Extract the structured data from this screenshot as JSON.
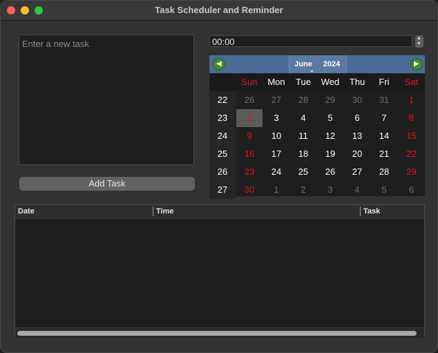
{
  "window": {
    "title": "Task Scheduler and Reminder"
  },
  "task_input": {
    "placeholder": "Enter a new task",
    "value": ""
  },
  "add_button": {
    "label": "Add Task"
  },
  "time_edit": {
    "value": "00:00"
  },
  "calendar": {
    "month": "June",
    "year": "2024",
    "day_headers": [
      "Sun",
      "Mon",
      "Tue",
      "Wed",
      "Thu",
      "Fri",
      "Sat"
    ],
    "selected_day": 2,
    "weeks": [
      {
        "week": "22",
        "days": [
          {
            "d": "26",
            "o": true
          },
          {
            "d": "27",
            "o": true
          },
          {
            "d": "28",
            "o": true
          },
          {
            "d": "29",
            "o": true
          },
          {
            "d": "30",
            "o": true
          },
          {
            "d": "31",
            "o": true
          },
          {
            "d": "1",
            "o": false
          }
        ]
      },
      {
        "week": "23",
        "days": [
          {
            "d": "2",
            "o": false
          },
          {
            "d": "3",
            "o": false
          },
          {
            "d": "4",
            "o": false
          },
          {
            "d": "5",
            "o": false
          },
          {
            "d": "6",
            "o": false
          },
          {
            "d": "7",
            "o": false
          },
          {
            "d": "8",
            "o": false
          }
        ]
      },
      {
        "week": "24",
        "days": [
          {
            "d": "9",
            "o": false
          },
          {
            "d": "10",
            "o": false
          },
          {
            "d": "11",
            "o": false
          },
          {
            "d": "12",
            "o": false
          },
          {
            "d": "13",
            "o": false
          },
          {
            "d": "14",
            "o": false
          },
          {
            "d": "15",
            "o": false
          }
        ]
      },
      {
        "week": "25",
        "days": [
          {
            "d": "16",
            "o": false
          },
          {
            "d": "17",
            "o": false
          },
          {
            "d": "18",
            "o": false
          },
          {
            "d": "19",
            "o": false
          },
          {
            "d": "20",
            "o": false
          },
          {
            "d": "21",
            "o": false
          },
          {
            "d": "22",
            "o": false
          }
        ]
      },
      {
        "week": "26",
        "days": [
          {
            "d": "23",
            "o": false
          },
          {
            "d": "24",
            "o": false
          },
          {
            "d": "25",
            "o": false
          },
          {
            "d": "26",
            "o": false
          },
          {
            "d": "27",
            "o": false
          },
          {
            "d": "28",
            "o": false
          },
          {
            "d": "29",
            "o": false
          }
        ]
      },
      {
        "week": "27",
        "days": [
          {
            "d": "30",
            "o": false
          },
          {
            "d": "1",
            "o": true
          },
          {
            "d": "2",
            "o": true
          },
          {
            "d": "3",
            "o": true
          },
          {
            "d": "4",
            "o": true
          },
          {
            "d": "5",
            "o": true
          },
          {
            "d": "6",
            "o": true
          }
        ]
      }
    ],
    "icons": {
      "prev": "arrow-left-icon",
      "next": "arrow-right-icon"
    },
    "colors": {
      "weekend": "#e0141e",
      "nav_bar": "#4a6c96",
      "nav_button": "#3f8a2e"
    }
  },
  "table": {
    "columns": [
      "Date",
      "Time",
      "Task"
    ],
    "rows": []
  }
}
